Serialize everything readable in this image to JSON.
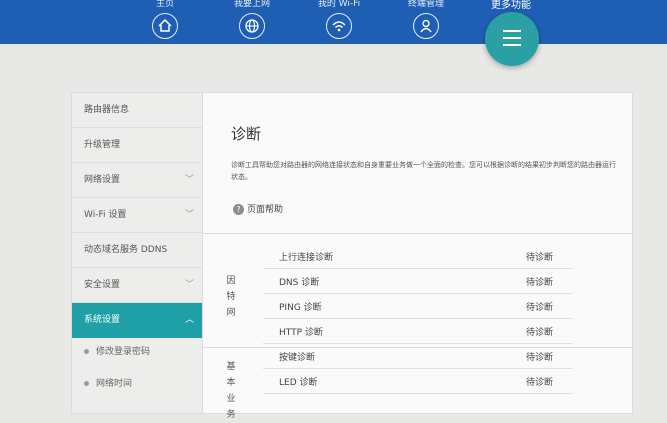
{
  "nav": {
    "items": [
      {
        "label": "主页",
        "icon": "home-icon"
      },
      {
        "label": "我要上网",
        "icon": "globe-icon"
      },
      {
        "label": "我的 Wi-Fi",
        "icon": "wifi-icon"
      },
      {
        "label": "终端管理",
        "icon": "user-icon"
      }
    ],
    "more_label": "更多功能",
    "more_icon": "menu-icon"
  },
  "sidebar": {
    "items": [
      {
        "label": "路由器信息"
      },
      {
        "label": "升级管理"
      },
      {
        "label": "网络设置"
      },
      {
        "label": "Wi-Fi 设置"
      },
      {
        "label": "动态域名服务 DDNS"
      },
      {
        "label": "安全设置"
      },
      {
        "label": "系统设置"
      }
    ],
    "subitems": [
      {
        "label": "修改登录密码"
      },
      {
        "label": "网络时间"
      }
    ]
  },
  "main": {
    "title": "诊断",
    "description": "诊断工具帮助您对路由器的网络连接状态和自身重要业务做一个全面的检查。您可以根据诊断的结果初步判断您的路由器运行状态。",
    "help_label": "页面帮助",
    "groups": [
      {
        "label": "因特网",
        "rows": [
          {
            "name": "上行连接诊断",
            "status": "待诊断"
          },
          {
            "name": "DNS 诊断",
            "status": "待诊断"
          },
          {
            "name": "PING 诊断",
            "status": "待诊断"
          },
          {
            "name": "HTTP 诊断",
            "status": "待诊断"
          }
        ]
      },
      {
        "label": "基本业务",
        "rows": [
          {
            "name": "按键诊断",
            "status": "待诊断"
          },
          {
            "name": "LED 诊断",
            "status": "待诊断"
          }
        ]
      }
    ]
  },
  "colors": {
    "topbar": "#1f5fb3",
    "accent": "#1fa0a6"
  }
}
